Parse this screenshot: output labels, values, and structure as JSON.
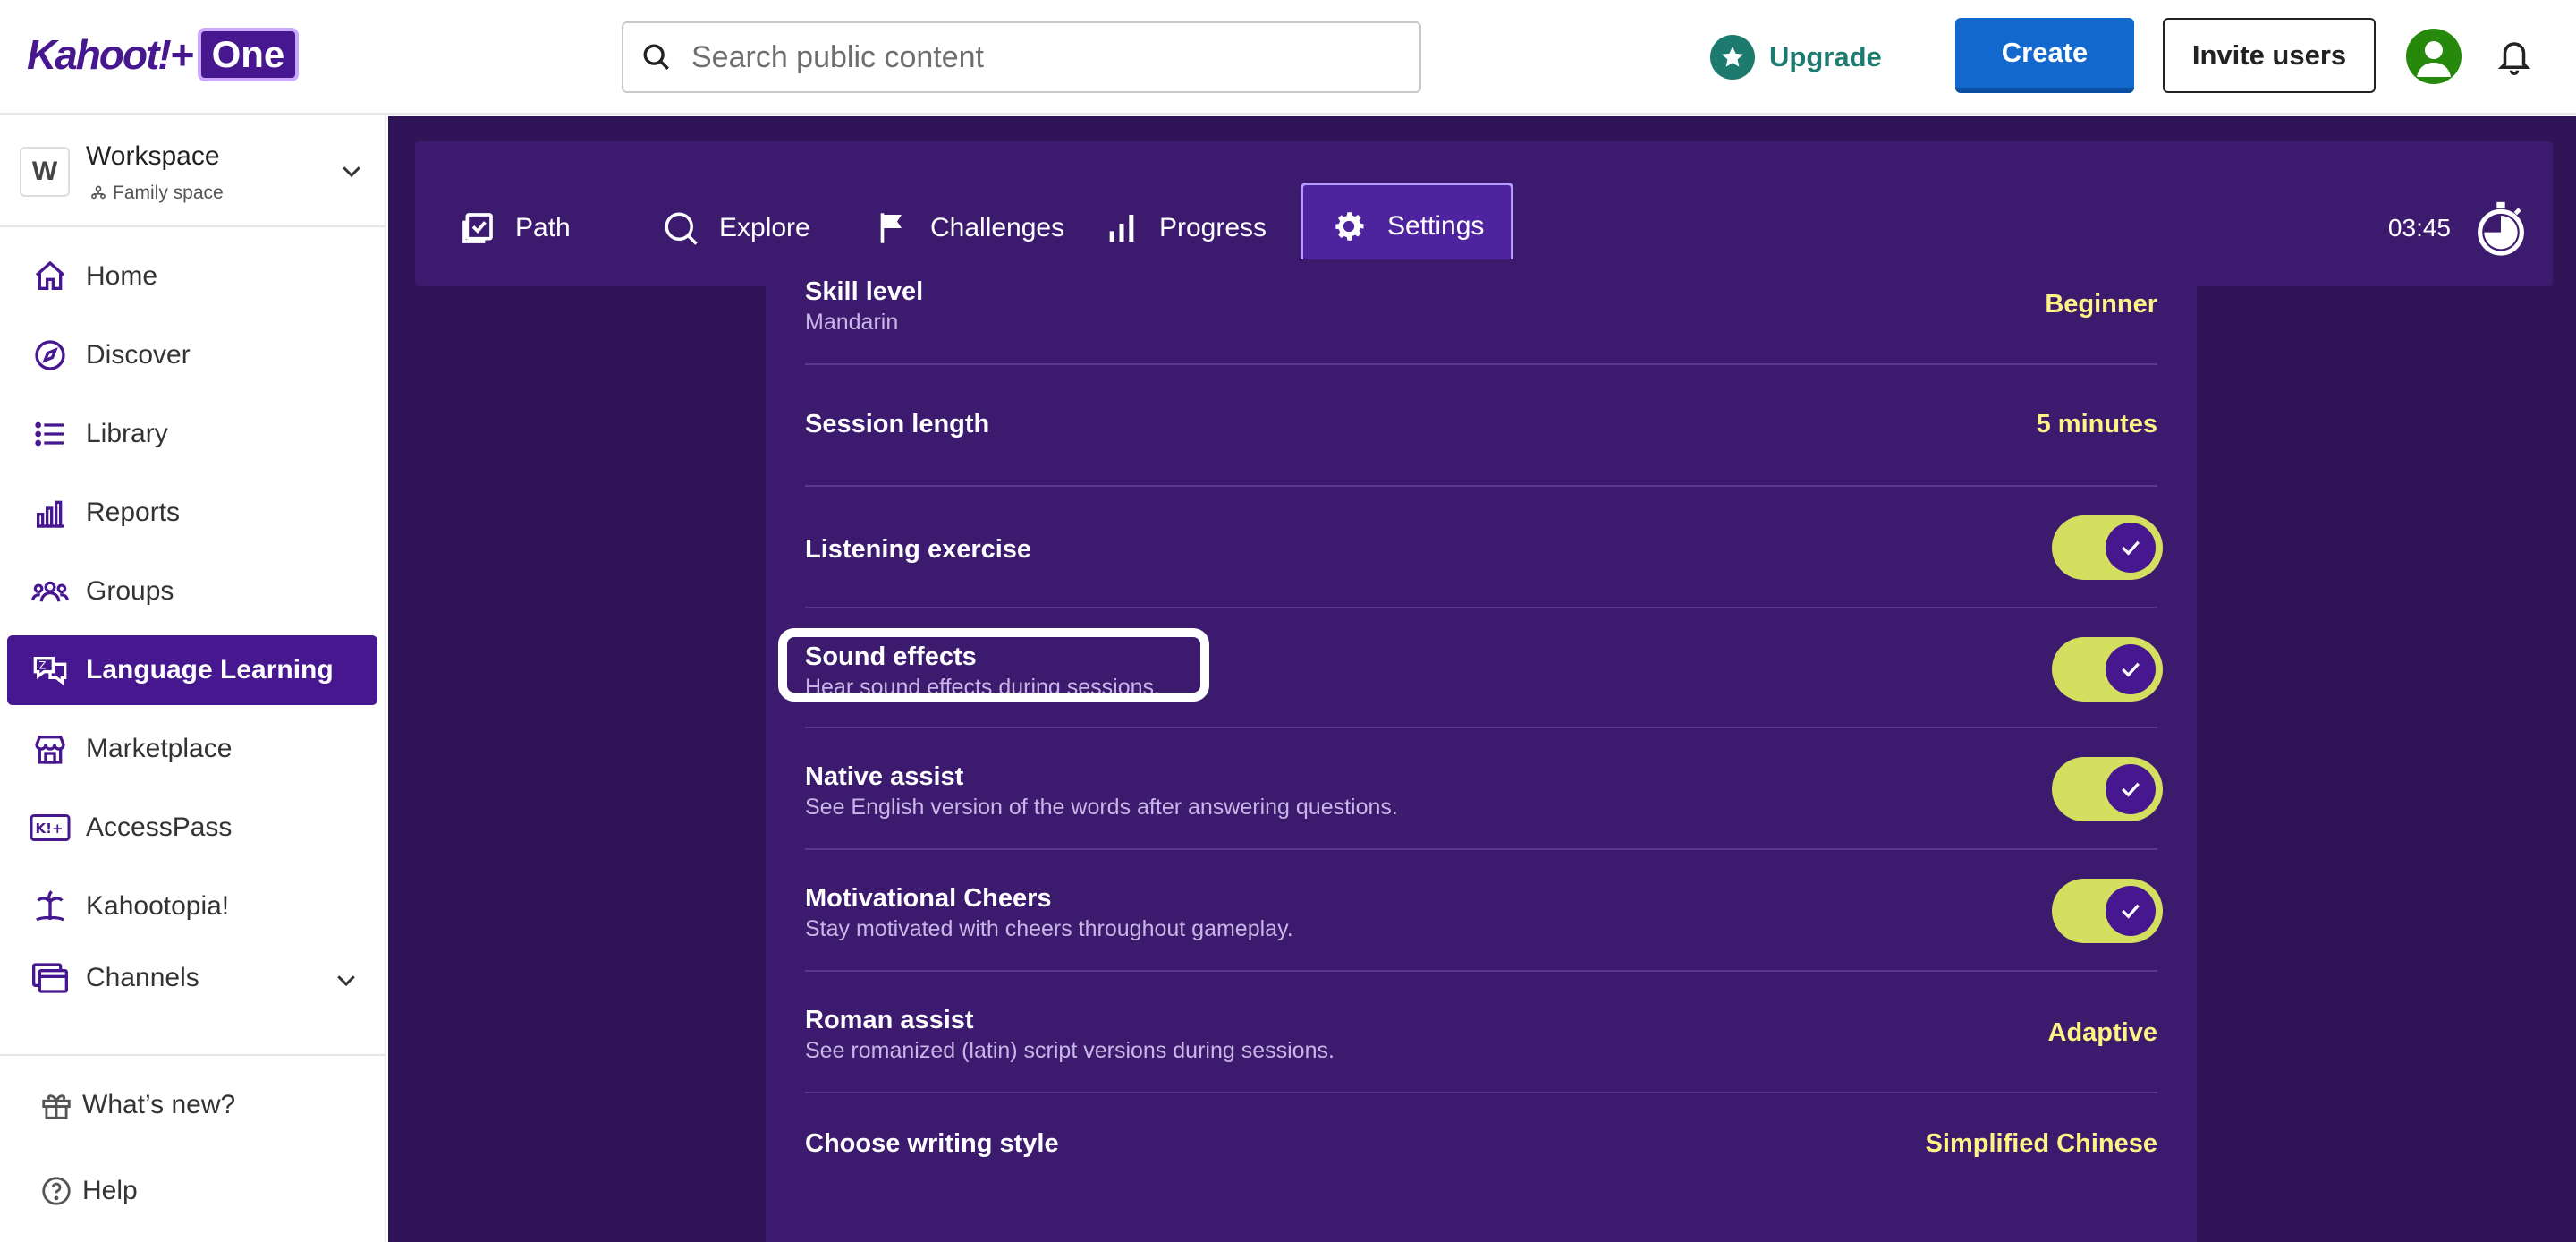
{
  "brand": {
    "logo_text": "Kahoot!+",
    "logo_badge": "One"
  },
  "header": {
    "search_placeholder": "Search public content",
    "upgrade_label": "Upgrade",
    "create_label": "Create",
    "invite_label": "Invite users"
  },
  "workspace": {
    "initial": "W",
    "name": "Workspace",
    "subtitle": "Family space"
  },
  "sidebar": {
    "items": [
      {
        "label": "Home",
        "icon": "home-icon"
      },
      {
        "label": "Discover",
        "icon": "compass-icon"
      },
      {
        "label": "Library",
        "icon": "list-icon"
      },
      {
        "label": "Reports",
        "icon": "bar-chart-icon"
      },
      {
        "label": "Groups",
        "icon": "groups-icon"
      },
      {
        "label": "Language Learning",
        "icon": "language-icon",
        "active": true
      },
      {
        "label": "Marketplace",
        "icon": "store-icon"
      },
      {
        "label": "AccessPass",
        "icon": "accesspass-icon"
      },
      {
        "label": "Kahootopia!",
        "icon": "island-icon"
      },
      {
        "label": "Channels",
        "icon": "channels-icon"
      }
    ],
    "footer": [
      {
        "label": "What’s new?",
        "icon": "gift-icon"
      },
      {
        "label": "Help",
        "icon": "help-icon"
      }
    ]
  },
  "tabs": [
    {
      "label": "Path",
      "icon": "path-icon"
    },
    {
      "label": "Explore",
      "icon": "search-icon"
    },
    {
      "label": "Challenges",
      "icon": "flag-icon"
    },
    {
      "label": "Progress",
      "icon": "progress-icon"
    },
    {
      "label": "Settings",
      "icon": "gear-icon",
      "active": true
    }
  ],
  "timer": {
    "value": "03:45"
  },
  "settings": {
    "skill": {
      "title": "Skill level",
      "subtitle": "Mandarin",
      "value": "Beginner"
    },
    "session": {
      "title": "Session length",
      "value": "5 minutes"
    },
    "listening": {
      "title": "Listening exercise",
      "enabled": true
    },
    "sound": {
      "title": "Sound effects",
      "subtitle": "Hear sound effects during sessions.",
      "enabled": true
    },
    "native": {
      "title": "Native assist",
      "subtitle": "See English version of the words after answering questions.",
      "enabled": true
    },
    "cheers": {
      "title": "Motivational Cheers",
      "subtitle": "Stay motivated with cheers throughout gameplay.",
      "enabled": true
    },
    "roman": {
      "title": "Roman assist",
      "subtitle": "See romanized (latin) script versions during sessions.",
      "value": "Adaptive"
    },
    "writing": {
      "title": "Choose writing style",
      "value": "Simplified Chinese"
    }
  },
  "colors": {
    "brand_purple": "#46178f",
    "main_bg": "#2f1457",
    "panel_bg": "#3c1a6e",
    "toggle_on": "#d4df5f",
    "value_yellow": "#fff385",
    "create_blue": "#1368ce",
    "upgrade_teal": "#1d7a6f"
  }
}
